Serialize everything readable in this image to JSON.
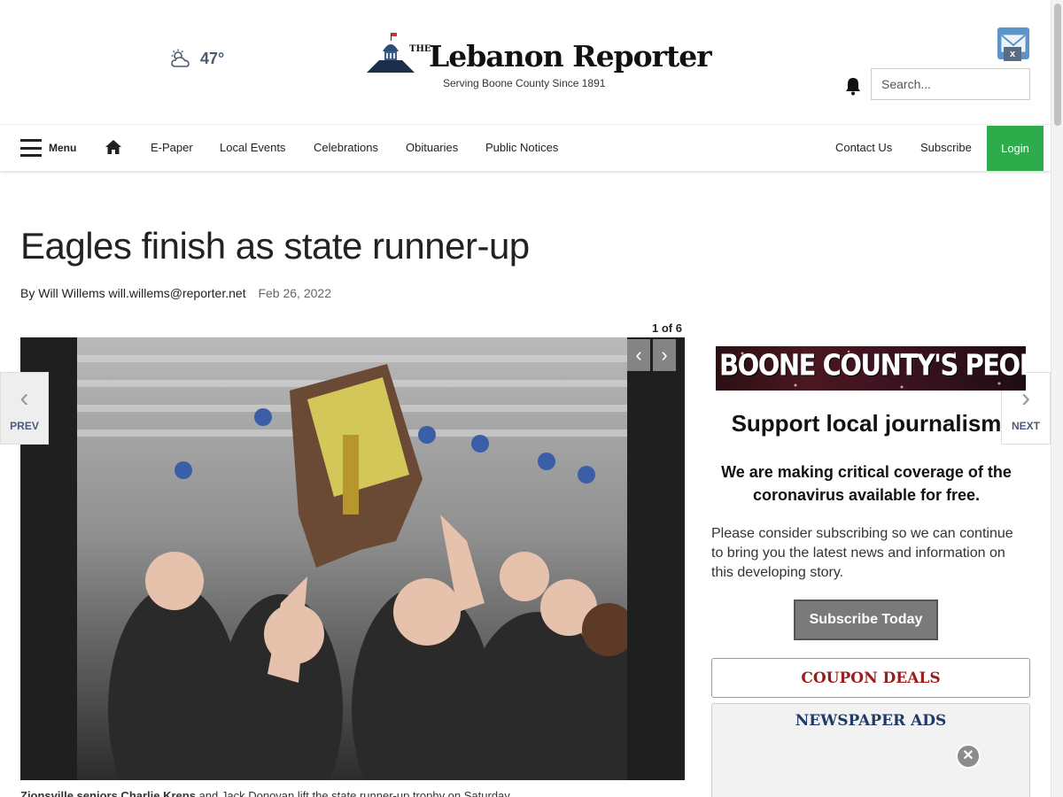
{
  "header": {
    "weather_temp": "47°",
    "logo_the": "THE",
    "logo_title": "Lebanon Reporter",
    "logo_tagline": "Serving Boone County Since 1891",
    "search_placeholder": "Search..."
  },
  "nav": {
    "menu_label": "Menu",
    "links": [
      "E-Paper",
      "Local Events",
      "Celebrations",
      "Obituaries",
      "Public Notices"
    ],
    "right_links": [
      "Contact Us",
      "Subscribe"
    ],
    "login_label": "Login",
    "accent": "#2eab4a"
  },
  "article": {
    "headline": "Eagles finish as state runner-up",
    "author": "By Will Willems will.willems@reporter.net",
    "date": "Feb 26, 2022",
    "photo_counter": "1 of 6",
    "caption_bold": "Zionsville seniors Charlie Kreps",
    "caption_rest": " and Jack Donovan lift the state runner-up trophy on Saturday."
  },
  "gallery_nav": {
    "prev_label": "PREV",
    "next_label": "NEXT"
  },
  "sidebar": {
    "banner_text": "BOONE COUNTY'S PEOPLE'S CHOICE!",
    "support_title": "Support local journalism",
    "support_subtitle": "We are making critical coverage of the coronavirus available for free.",
    "support_body": "Please consider subscribing so we can continue to bring you the latest news and information on this developing story.",
    "subscribe_button": "Subscribe Today",
    "coupon_label": "COUPON DEALS",
    "ads_label": "NEWSPAPER ADS"
  }
}
